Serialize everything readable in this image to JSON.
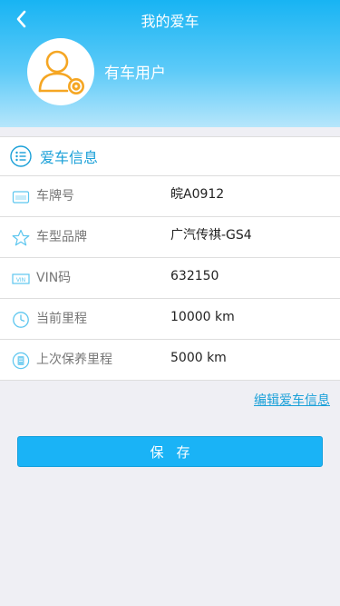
{
  "header": {
    "title": "我的爱车",
    "user_label": "有车用户"
  },
  "card": {
    "title": "爱车信息",
    "rows": [
      {
        "label": "车牌号",
        "value": "皖A0912",
        "icon": "license-plate-icon"
      },
      {
        "label": "车型品牌",
        "value": "广汽传祺-GS4",
        "icon": "star-icon"
      },
      {
        "label": "VIN码",
        "value": "632150",
        "icon": "vin-icon"
      },
      {
        "label": "当前里程",
        "value": "10000 km",
        "icon": "odometer-icon"
      },
      {
        "label": "上次保养里程",
        "value": "5000 km",
        "icon": "maintenance-icon"
      }
    ]
  },
  "edit_link": "编辑爱车信息",
  "save_button": "保存",
  "colors": {
    "accent": "#1aa0d8",
    "button": "#1ab3f6",
    "avatar": "#f5a623"
  }
}
